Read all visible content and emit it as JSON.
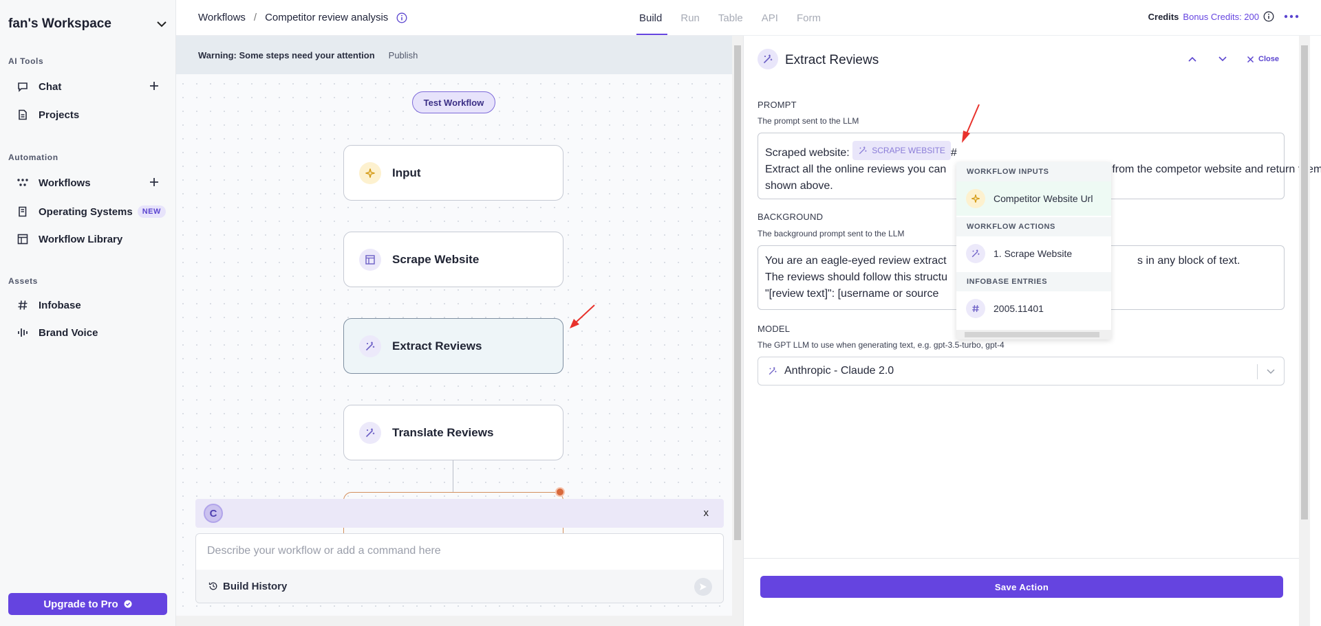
{
  "sidebar": {
    "workspace": "fan's Workspace",
    "sections": {
      "ai_tools": "AI Tools",
      "automation": "Automation",
      "assets": "Assets"
    },
    "items": {
      "chat": "Chat",
      "projects": "Projects",
      "workflows": "Workflows",
      "operating_systems": "Operating Systems",
      "operating_systems_badge": "NEW",
      "workflow_library": "Workflow Library",
      "infobase": "Infobase",
      "brand_voice": "Brand Voice"
    },
    "upgrade": "Upgrade to Pro"
  },
  "header": {
    "breadcrumb_root": "Workflows",
    "breadcrumb_sep": "/",
    "breadcrumb_current": "Competitor review analysis",
    "tabs": [
      "Build",
      "Run",
      "Table",
      "API",
      "Form"
    ],
    "active_tab": "Build",
    "credits_label": "Credits",
    "bonus_credits": "Bonus Credits: 200"
  },
  "canvas": {
    "warning": "Warning: Some steps need your attention",
    "publish": "Publish",
    "test_button": "Test Workflow",
    "nodes": [
      "Input",
      "Scrape Website",
      "Extract Reviews",
      "Translate Reviews"
    ],
    "selected_node": "Extract Reviews"
  },
  "chat": {
    "logo": "C",
    "close": "x",
    "placeholder": "Describe your workflow or add a command here",
    "build_history": "Build History"
  },
  "panel": {
    "title": "Extract Reviews",
    "close": "Close",
    "prompt": {
      "label": "PROMPT",
      "help": "The prompt sent to the LLM",
      "prefix": "Scraped website:",
      "tag": "SCRAPE WEBSITE",
      "hash": "#",
      "line1_tail": "d from the competor website and return them in the format",
      "line2_start": "Extract all the online reviews you can",
      "line3": "shown above."
    },
    "background": {
      "label": "BACKGROUND",
      "help": "The background prompt sent to the LLM",
      "line1_start": "You are an eagle-eyed review extract",
      "line1_end": "s in any block of text.",
      "line2": "The reviews should follow this structu",
      "line3": "\"[review text]\": [username or source"
    },
    "model": {
      "label": "MODEL",
      "help": "The GPT LLM to use when generating text, e.g. gpt-3.5-turbo, gpt-4",
      "value": "Anthropic - Claude 2.0"
    },
    "save": "Save Action"
  },
  "popup": {
    "sections": [
      "WORKFLOW INPUTS",
      "WORKFLOW ACTIONS",
      "INFOBASE ENTRIES"
    ],
    "items": [
      "Competitor Website Url",
      "1. Scrape Website",
      "2005.11401"
    ]
  },
  "colors": {
    "accent": "#6544e0",
    "annotation_arrow": "#e8322c",
    "input_icon_bg": "#fdf1cf",
    "warning_bar": "#e6ebf0"
  }
}
